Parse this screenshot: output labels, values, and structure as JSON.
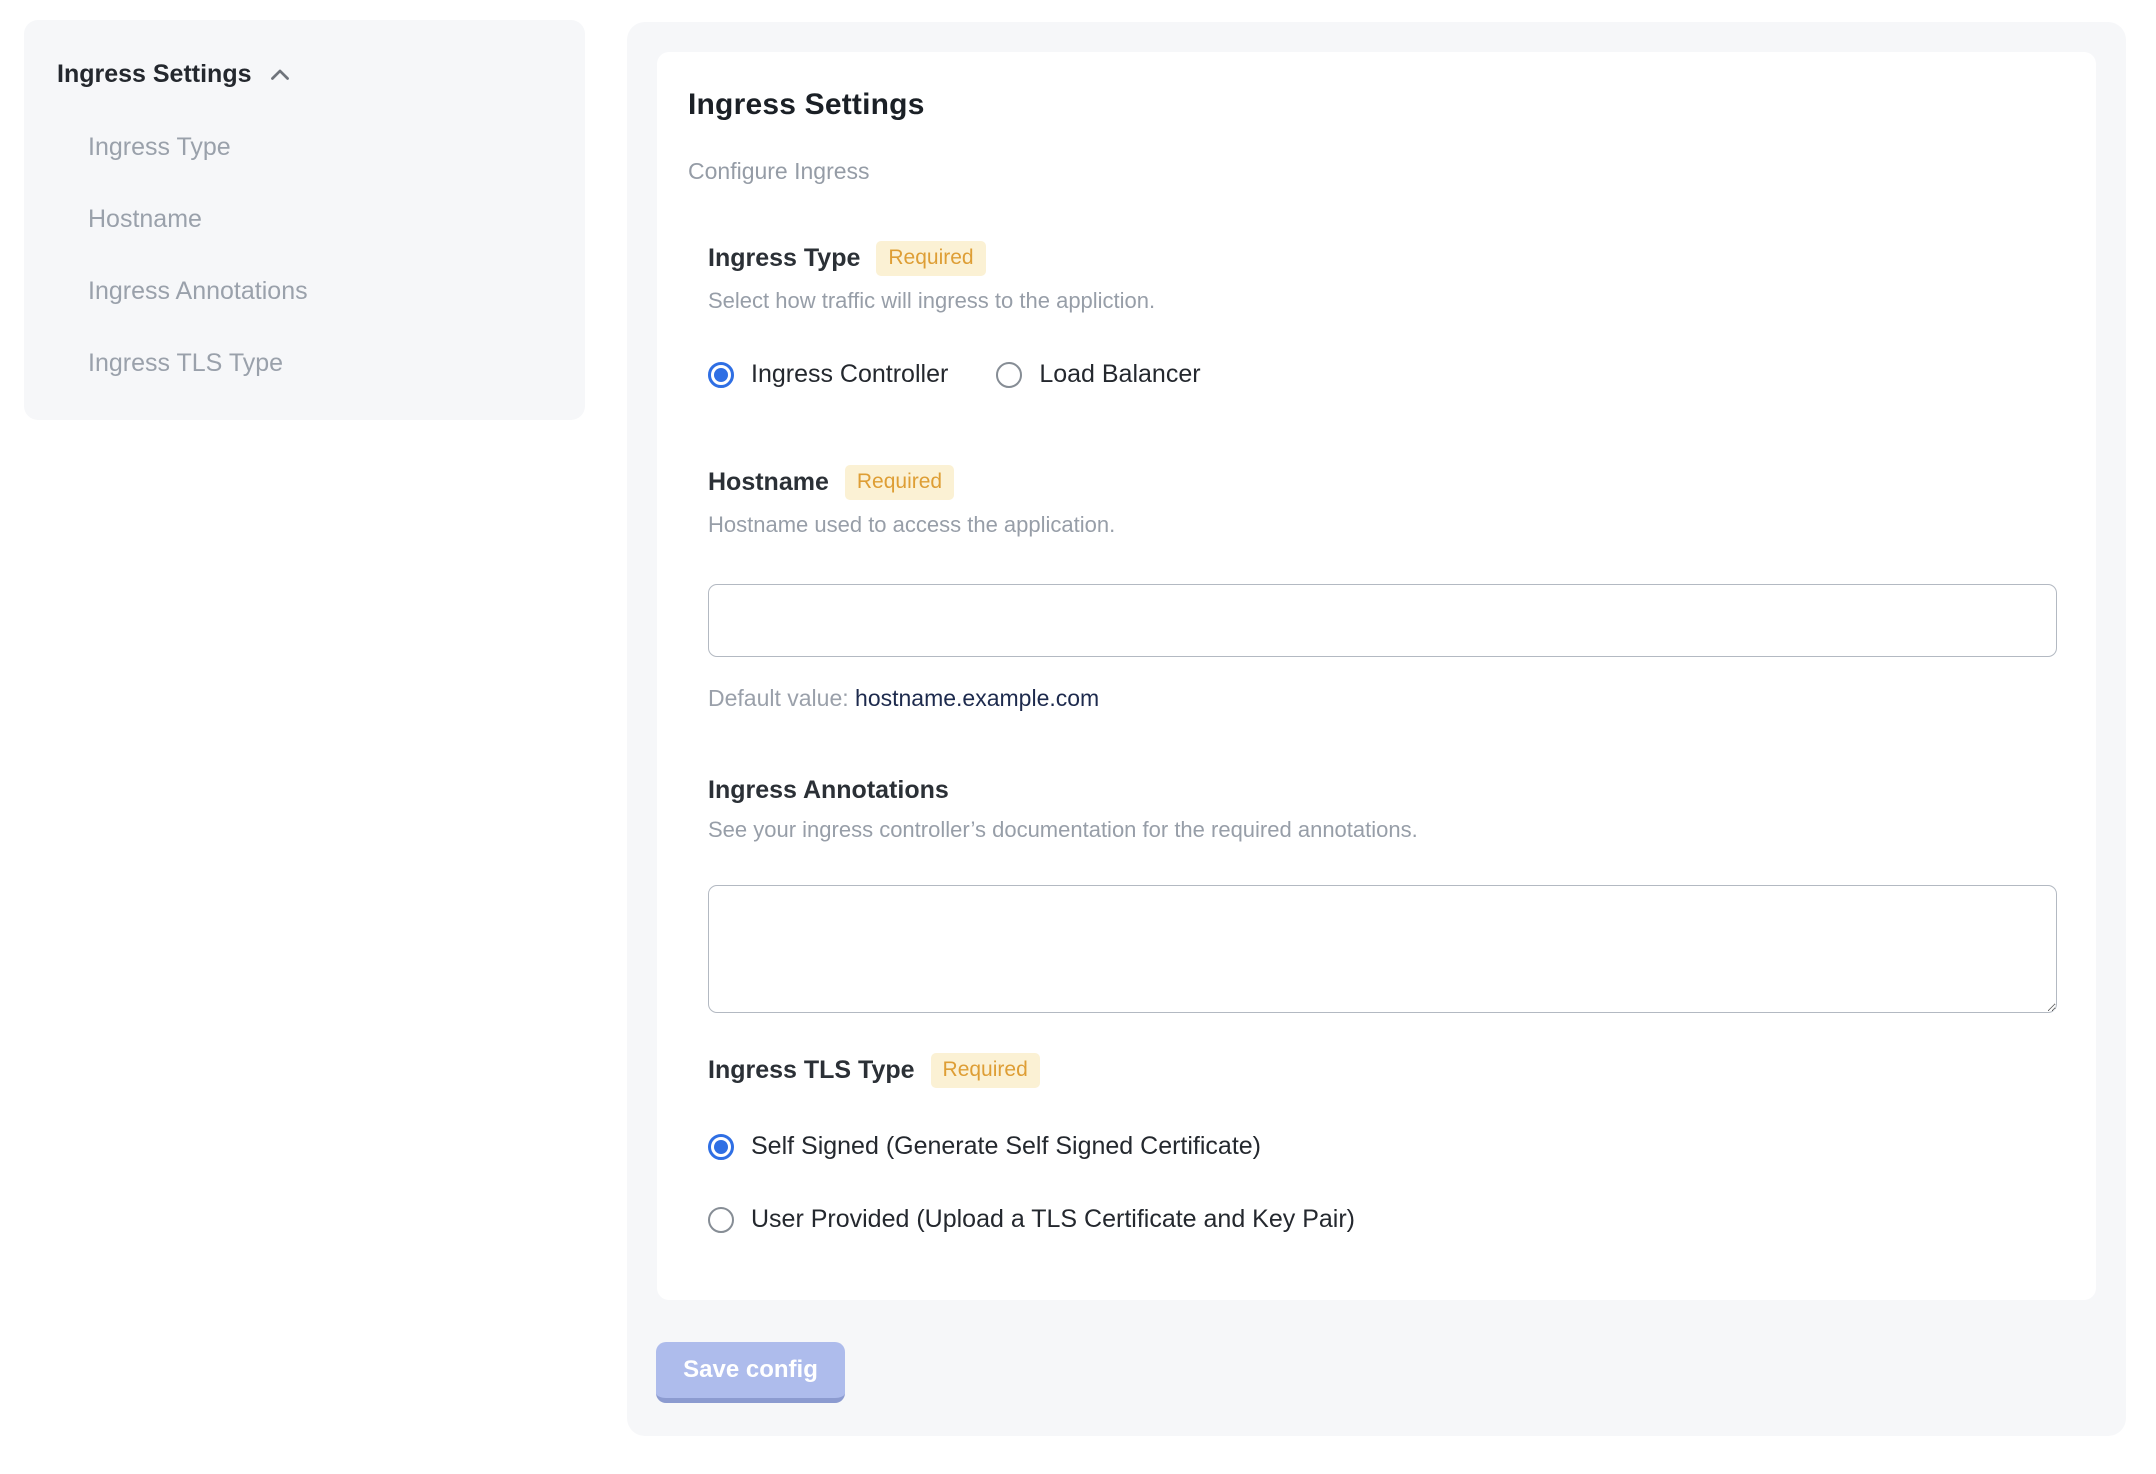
{
  "sidebar": {
    "title": "Ingress Settings",
    "collapse_icon": "chevron-up-icon",
    "items": [
      {
        "label": "Ingress Type"
      },
      {
        "label": "Hostname"
      },
      {
        "label": "Ingress Annotations"
      },
      {
        "label": "Ingress TLS Type"
      }
    ]
  },
  "main": {
    "title": "Ingress Settings",
    "subtitle": "Configure Ingress",
    "sections": {
      "ingress_type": {
        "label": "Ingress Type",
        "required_badge": "Required",
        "helper": "Select how traffic will ingress to the appliction.",
        "options": [
          {
            "label": "Ingress Controller",
            "selected": true
          },
          {
            "label": "Load Balancer",
            "selected": false
          }
        ]
      },
      "hostname": {
        "label": "Hostname",
        "required_badge": "Required",
        "helper": "Hostname used to access the application.",
        "input_value": "",
        "default_label": "Default value:",
        "default_value": "hostname.example.com"
      },
      "annotations": {
        "label": "Ingress Annotations",
        "helper": "See your ingress controller’s documentation for the required annotations.",
        "textarea_value": ""
      },
      "tls": {
        "label": "Ingress TLS Type",
        "required_badge": "Required",
        "options": [
          {
            "label": "Self Signed (Generate Self Signed Certificate)",
            "selected": true
          },
          {
            "label": "User Provided (Upload a TLS Certificate and Key Pair)",
            "selected": false
          }
        ]
      }
    },
    "save_button_label": "Save config"
  },
  "colors": {
    "accent_blue": "#2f6fe4",
    "badge_bg": "#fbf1d4",
    "badge_text": "#de9e35",
    "panel_bg": "#f6f7f9",
    "save_button_bg": "#aebcec",
    "save_button_edge": "#8c9bd0",
    "default_value_text": "#1d2a4d"
  }
}
